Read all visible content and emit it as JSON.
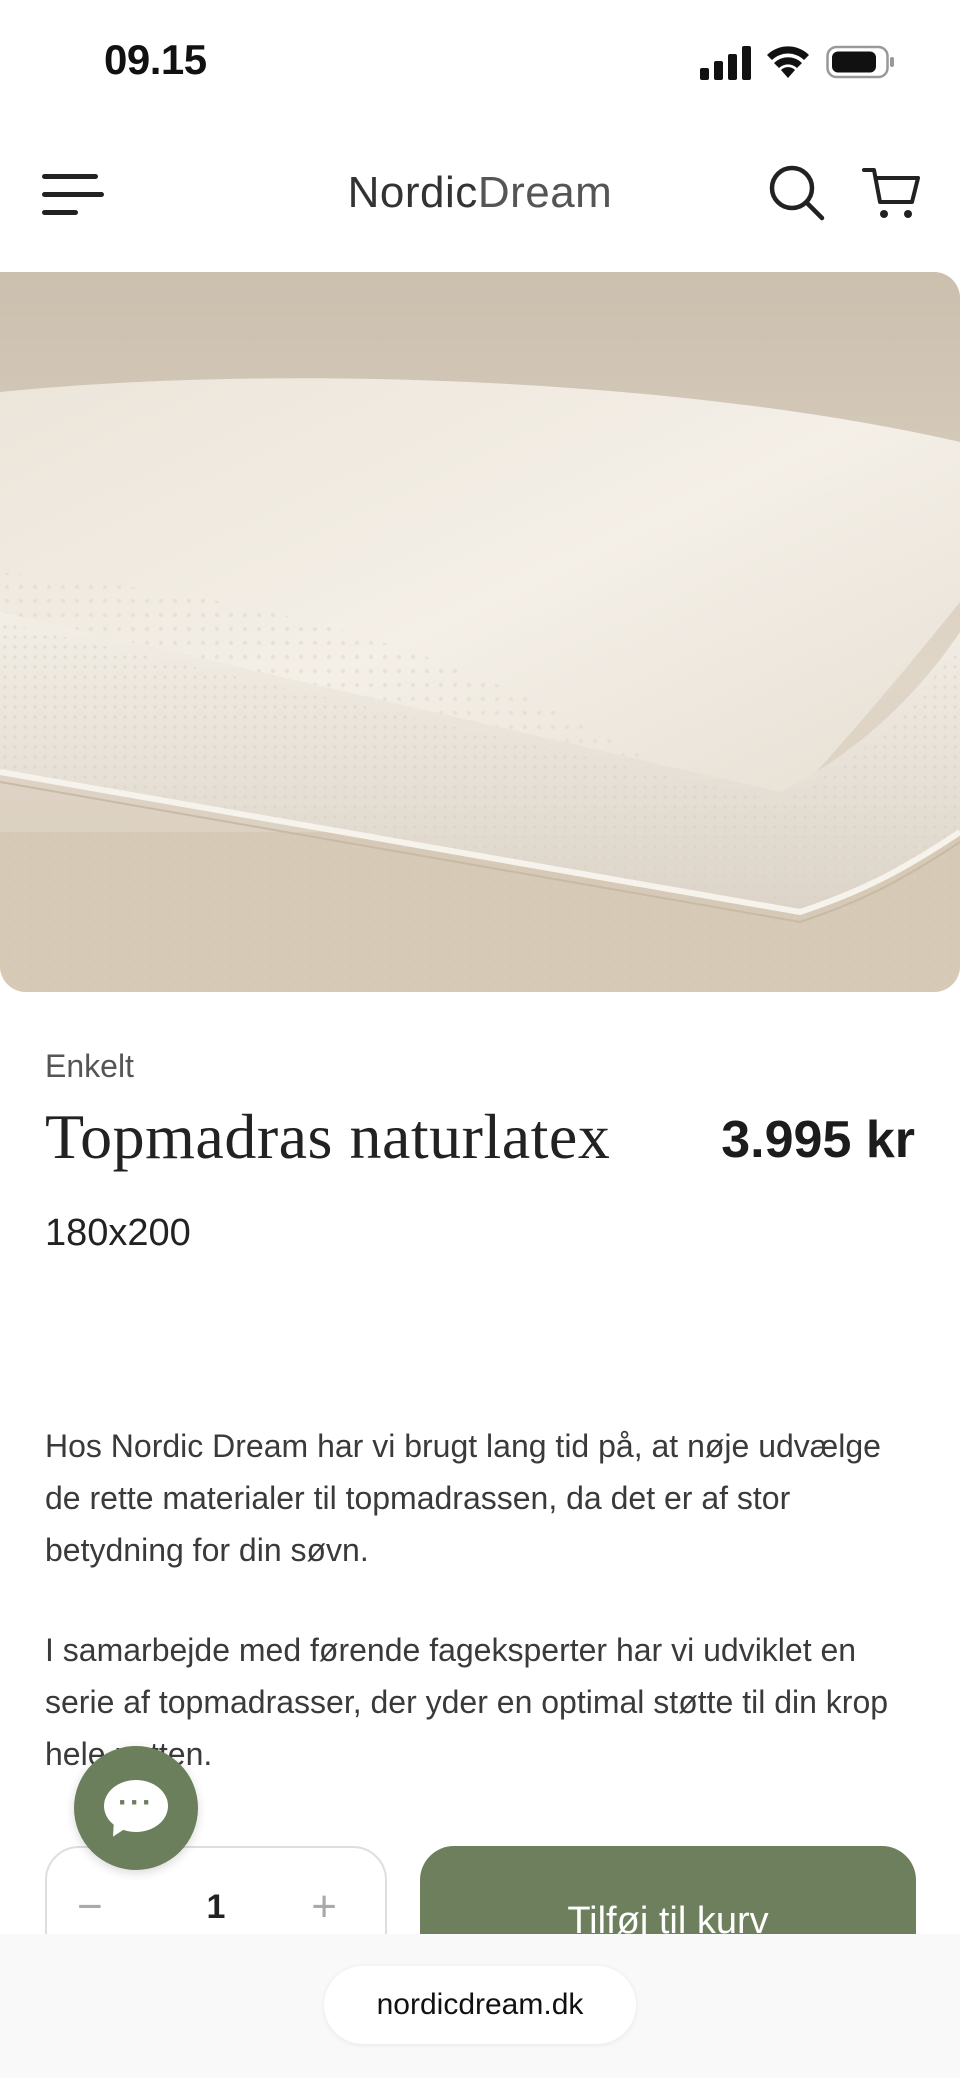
{
  "status_bar": {
    "time": "09.15"
  },
  "header": {
    "logo_bold": "Nordic",
    "logo_light": "Dream"
  },
  "product": {
    "variant": "Enkelt",
    "title": "Topmadras naturlatex",
    "price": "3.995 kr",
    "size": "180x200",
    "description": [
      "Hos Nordic Dream har vi brugt lang tid på, at nøje udvælge de rette materialer til topmadrassen, da det er af stor betydning for din søvn.",
      "I samarbejde med førende fageksperter har vi udviklet en serie af topmadrasser, der yder en optimal støtte til din krop hele natten."
    ]
  },
  "purchase": {
    "quantity": "1",
    "minus": "−",
    "plus": "+",
    "add_to_cart": "Tilføj til kurv"
  },
  "chat": {
    "dots": "···"
  },
  "browser": {
    "url": "nordicdream.dk"
  },
  "colors": {
    "accent": "#6d7f5c",
    "text": "#222222"
  }
}
